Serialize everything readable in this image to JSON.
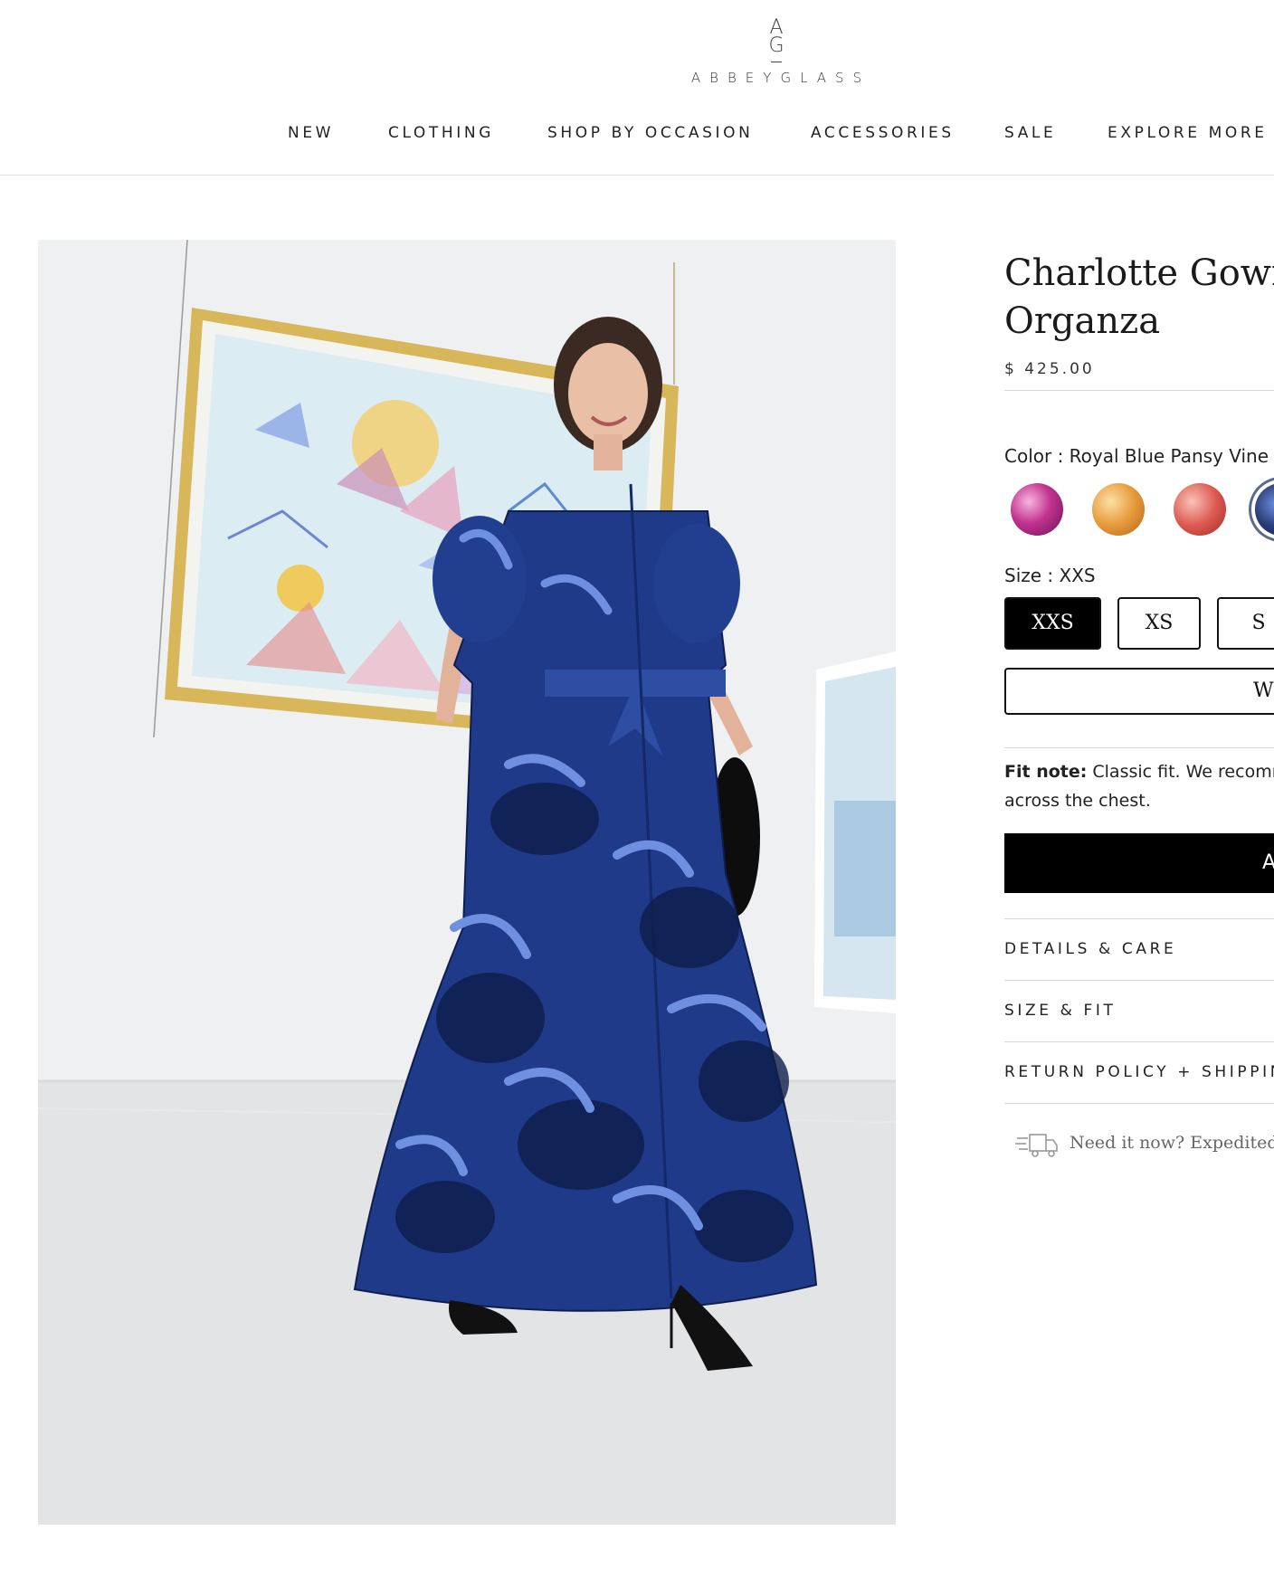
{
  "brand": {
    "mark_top": "A",
    "mark_bottom": "G",
    "name": "ABBEYGLASS"
  },
  "nav": {
    "items": [
      "NEW",
      "CLOTHING",
      "SHOP BY OCCASION",
      "ACCESSORIES",
      "SALE",
      "EXPLORE MORE"
    ]
  },
  "product": {
    "title_line1": "Charlotte Gown R",
    "title_line2": "Organza",
    "price": "$ 425.00",
    "color_label": "Color : Royal Blue Pansy Vine",
    "swatches": [
      {
        "name": "magenta floral",
        "color": "#c2338f"
      },
      {
        "name": "orange floral",
        "color": "#e79a3a"
      },
      {
        "name": "coral floral",
        "color": "#dd5a52"
      },
      {
        "name": "royal blue pansy vine",
        "color": "#2a3d78"
      }
    ],
    "size_label": "Size : XXS",
    "sizes": [
      "XXS",
      "XS",
      "S"
    ],
    "selected_size": "XXS",
    "wide_button_label": "W",
    "fit_note_label": "Fit note:",
    "fit_note_line1": " Classic fit. We recomm",
    "fit_note_line2": "across the chest.",
    "add_button_label": "A",
    "accordions": [
      "DETAILS & CARE",
      "SIZE & FIT",
      "RETURN POLICY + SHIPPING"
    ],
    "shipping_note": "Need it now? Expedited sh"
  }
}
